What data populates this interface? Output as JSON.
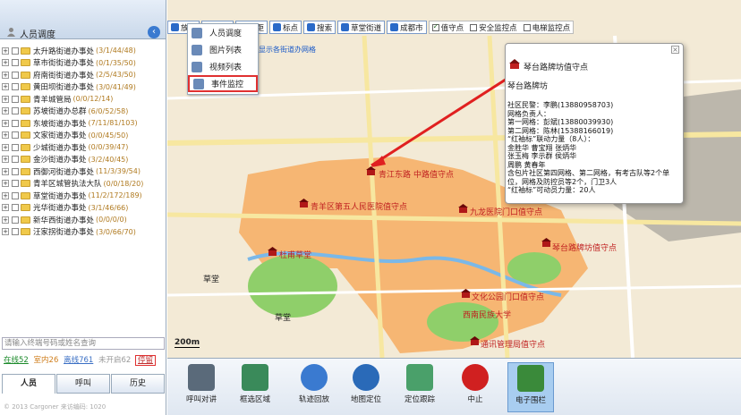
{
  "panel": {
    "title": "人员调度"
  },
  "tree": [
    {
      "name": "太升路街道办事处",
      "count": "(3/1/44/48)"
    },
    {
      "name": "草市街街道办事处",
      "count": "(0/1/35/50)"
    },
    {
      "name": "府南街街道办事处",
      "count": "(2/5/43/50)"
    },
    {
      "name": "黄田坝街道办事处",
      "count": "(3/0/41/49)"
    },
    {
      "name": "青羊城管局",
      "count": "(0/0/12/14)"
    },
    {
      "name": "苏坡街道办总群",
      "count": "(6/0/52/58)"
    },
    {
      "name": "东坡街道办事处",
      "count": "(7/11/81/103)"
    },
    {
      "name": "文家街道办事处",
      "count": "(0/0/45/50)"
    },
    {
      "name": "少城街道办事处",
      "count": "(0/0/39/47)"
    },
    {
      "name": "金沙街道办事处",
      "count": "(3/2/40/45)"
    },
    {
      "name": "西御河街道办事处",
      "count": "(11/3/39/54)"
    },
    {
      "name": "青羊区城管执法大队",
      "count": "(0/0/18/20)"
    },
    {
      "name": "草堂街道办事处",
      "count": "(11/2/172/189)"
    },
    {
      "name": "光华街道办事处",
      "count": "(3/1/46/66)"
    },
    {
      "name": "新华西街道办事处",
      "count": "(0/0/0/0)"
    },
    {
      "name": "汪家拐街道办事处",
      "count": "(3/0/66/70)"
    }
  ],
  "search": {
    "placeholder": "请输入终端号码或姓名查询"
  },
  "status": {
    "online": "在线52",
    "indoor": "室内26",
    "offline": "离线761",
    "not_on": "未开启62",
    "stay": "停留"
  },
  "tabs": [
    "人员",
    "呼叫",
    "历史"
  ],
  "copyright": "© 2013 Cargoner  来访编码: 1020",
  "toolbar": {
    "zoom_in": "放大",
    "zoom_out": "缩小",
    "measure": "测距",
    "mark": "标点",
    "search": "搜索",
    "street": "草堂街道",
    "city": "成都市",
    "chk_duty": "值守点",
    "chk_safety": "安全监控点",
    "chk_elev": "电梯监控点"
  },
  "menu": [
    "人员调度",
    "图片列表",
    "视频列表",
    "事件监控"
  ],
  "grid_link": "显示各街道办网格",
  "popup": {
    "title": "琴台路牌坊值守点",
    "subtitle": "琴台路牌坊",
    "body": [
      "社区民警：李鹏(13880958703)",
      "网格负责人：",
      "第一网格：彭斌(13880039930)",
      "第二网格：陈林(15388166019)",
      "“红袖标”联动力量（8人）：",
      "金胜华 曹宝翔 张炳华",
      "张玉梅 李示群 侯炳华",
      "周鹏 黄春年",
      "含包片社区第四网格、第二网格，有考古队等2个单位，网格及防控员等2个，门卫3人",
      "“红袖标”可动员力量：20人"
    ]
  },
  "map_labels": [
    "青江东路",
    "中路值守点",
    "青羊区第五人民医院值守点",
    "九龙医院门口值守点",
    "琴台路牌坊值守点",
    "草堂",
    "草堂",
    "文化公园门口值守点",
    "通讯管理局值守点",
    "杜甫草堂",
    "西南民族大学"
  ],
  "scale": "200m",
  "bottom": [
    "呼叫对讲",
    "框选区域",
    "轨迹回放",
    "地图定位",
    "定位跟踪",
    "中止",
    "电子围栏"
  ]
}
